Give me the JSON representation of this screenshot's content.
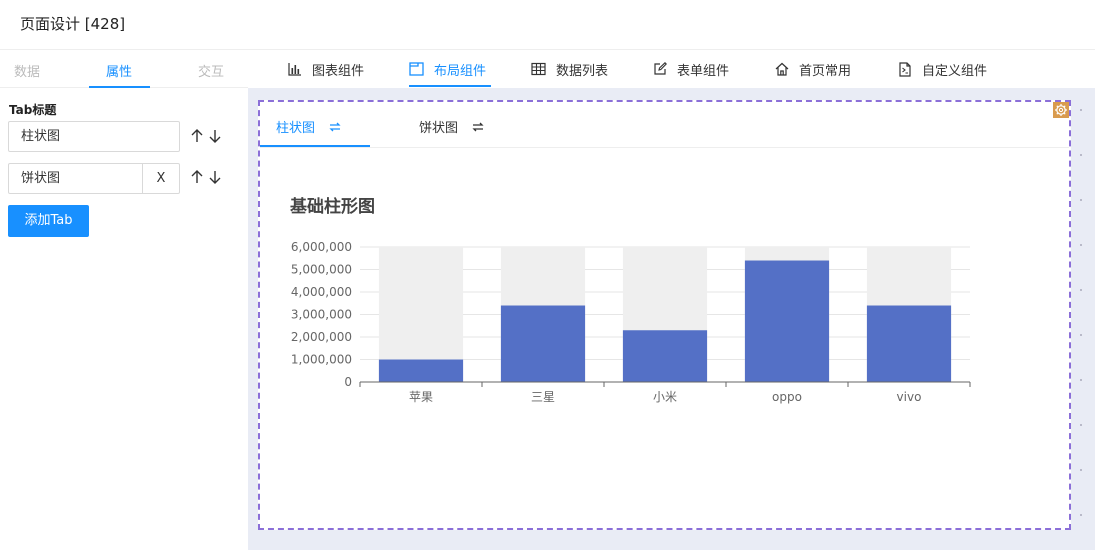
{
  "header": {
    "title": "页面设计 [428]"
  },
  "left_panel": {
    "tabs": [
      "数据",
      "属性",
      "交互"
    ],
    "active_tab": 1,
    "section_label": "Tab标题",
    "tab_titles": [
      "柱状图",
      "饼状图"
    ],
    "remove_label": "X",
    "add_button": "添加Tab"
  },
  "toolbar": {
    "tabs": [
      {
        "label": "图表组件",
        "icon": "bar-chart-icon"
      },
      {
        "label": "布局组件",
        "icon": "layout-icon"
      },
      {
        "label": "数据列表",
        "icon": "table-icon"
      },
      {
        "label": "表单组件",
        "icon": "edit-icon"
      },
      {
        "label": "首页常用",
        "icon": "home-icon"
      },
      {
        "label": "自定义组件",
        "icon": "custom-doc-icon"
      }
    ],
    "active_tab": 1
  },
  "canvas": {
    "tabs": [
      "柱状图",
      "饼状图"
    ],
    "active_tab": 0,
    "accent_color": "#1890ff",
    "selection_border": "#8b6fd8"
  },
  "chart_data": {
    "type": "bar",
    "title": "基础柱形图",
    "categories": [
      "苹果",
      "三星",
      "小米",
      "oppo",
      "vivo"
    ],
    "values": [
      1000000,
      3400000,
      2300000,
      5400000,
      3400000
    ],
    "yticks": [
      "0",
      "1,000,000",
      "2,000,000",
      "3,000,000",
      "4,000,000",
      "5,000,000",
      "6,000,000"
    ],
    "ylim": [
      0,
      6000000
    ],
    "bar_color": "#5470c6",
    "background_bar_color": "#efefef",
    "grid": true
  }
}
